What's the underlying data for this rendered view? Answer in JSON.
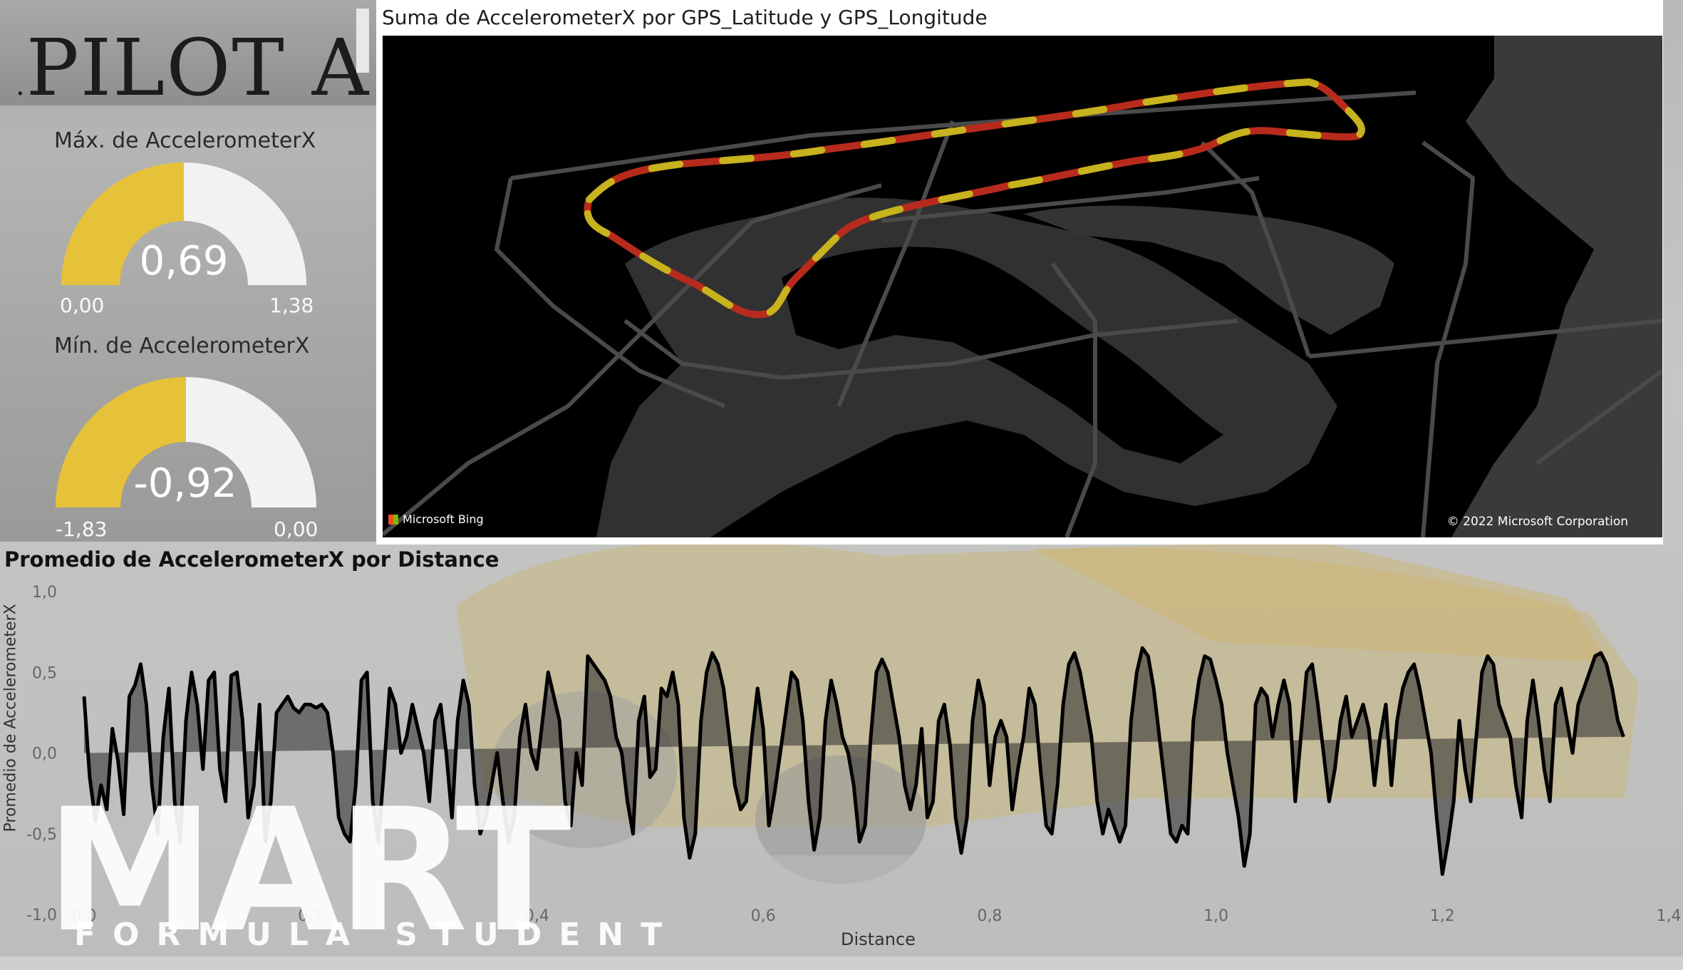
{
  "pilot": {
    "title": "PILOT A",
    "dot": "."
  },
  "gauge_max": {
    "title": "Máx. de AccelerometerX",
    "value": "0,69",
    "min": "0,00",
    "max": "1,38",
    "fill_fraction": 0.5
  },
  "gauge_min": {
    "title": "Mín. de AccelerometerX",
    "value": "-0,92",
    "min": "-1,83",
    "max": "0,00",
    "fill_fraction": 0.5
  },
  "map": {
    "title": "Suma de AccelerometerX por GPS_Latitude y GPS_Longitude",
    "bing": "Microsoft Bing",
    "copyright": "© 2022 Microsoft Corporation"
  },
  "line_chart": {
    "title": "Promedio de AccelerometerX por Distance",
    "xlabel": "Distance",
    "ylabel": "Promedio de AccelerometerX"
  },
  "logo": {
    "main": "MART",
    "sub": "FORMULA STUDENT"
  },
  "colors": {
    "gauge_fill": "#e6c13a",
    "gauge_empty": "#f2f2f2",
    "map_bg": "#000000",
    "line": "#000000"
  },
  "chart_data": {
    "type": "area",
    "title": "Promedio de AccelerometerX por Distance",
    "xlabel": "Distance",
    "ylabel": "Promedio de AccelerometerX",
    "xlim": [
      0,
      1.4
    ],
    "ylim": [
      -1.0,
      1.0
    ],
    "xticks": [
      "0,0",
      "0,2",
      "0,4",
      "0,6",
      "0,8",
      "1,0",
      "1,2",
      "1,4"
    ],
    "yticks": [
      "1,0",
      "0,5",
      "0,0",
      "-0,5",
      "-1,0"
    ],
    "x": [
      0.0,
      0.005,
      0.01,
      0.015,
      0.02,
      0.025,
      0.03,
      0.035,
      0.04,
      0.045,
      0.05,
      0.055,
      0.06,
      0.065,
      0.07,
      0.075,
      0.08,
      0.085,
      0.09,
      0.095,
      0.1,
      0.105,
      0.11,
      0.115,
      0.12,
      0.125,
      0.13,
      0.135,
      0.14,
      0.145,
      0.15,
      0.155,
      0.16,
      0.165,
      0.17,
      0.175,
      0.18,
      0.185,
      0.19,
      0.195,
      0.2,
      0.205,
      0.21,
      0.215,
      0.22,
      0.225,
      0.23,
      0.235,
      0.24,
      0.245,
      0.25,
      0.255,
      0.26,
      0.265,
      0.27,
      0.275,
      0.28,
      0.285,
      0.29,
      0.295,
      0.3,
      0.305,
      0.31,
      0.315,
      0.32,
      0.325,
      0.33,
      0.335,
      0.34,
      0.345,
      0.35,
      0.355,
      0.36,
      0.365,
      0.37,
      0.375,
      0.38,
      0.385,
      0.39,
      0.395,
      0.4,
      0.405,
      0.41,
      0.415,
      0.42,
      0.425,
      0.43,
      0.435,
      0.44,
      0.445,
      0.45,
      0.455,
      0.46,
      0.465,
      0.47,
      0.475,
      0.48,
      0.485,
      0.49,
      0.495,
      0.5,
      0.505,
      0.51,
      0.515,
      0.52,
      0.525,
      0.53,
      0.535,
      0.54,
      0.545,
      0.55,
      0.555,
      0.56,
      0.565,
      0.57,
      0.575,
      0.58,
      0.585,
      0.59,
      0.595,
      0.6,
      0.605,
      0.61,
      0.615,
      0.62,
      0.625,
      0.63,
      0.635,
      0.64,
      0.645,
      0.65,
      0.655,
      0.66,
      0.665,
      0.67,
      0.675,
      0.68,
      0.685,
      0.69,
      0.695,
      0.7,
      0.705,
      0.71,
      0.715,
      0.72,
      0.725,
      0.73,
      0.735,
      0.74,
      0.745,
      0.75,
      0.755,
      0.76,
      0.765,
      0.77,
      0.775,
      0.78,
      0.785,
      0.79,
      0.795,
      0.8,
      0.805,
      0.81,
      0.815,
      0.82,
      0.825,
      0.83,
      0.835,
      0.84,
      0.845,
      0.85,
      0.855,
      0.86,
      0.865,
      0.87,
      0.875,
      0.88,
      0.885,
      0.89,
      0.895,
      0.9,
      0.905,
      0.91,
      0.915,
      0.92,
      0.925,
      0.93,
      0.935,
      0.94,
      0.945,
      0.95,
      0.955,
      0.96,
      0.965,
      0.97,
      0.975,
      0.98,
      0.985,
      0.99,
      0.995,
      1.0,
      1.005,
      1.01,
      1.015,
      1.02,
      1.025,
      1.03,
      1.035,
      1.04,
      1.045,
      1.05,
      1.055,
      1.06,
      1.065,
      1.07,
      1.075,
      1.08,
      1.085,
      1.09,
      1.095,
      1.1,
      1.105,
      1.11,
      1.115,
      1.12,
      1.125,
      1.13,
      1.135,
      1.14,
      1.145,
      1.15,
      1.155,
      1.16,
      1.165,
      1.17,
      1.175,
      1.18,
      1.185,
      1.19,
      1.195,
      1.2,
      1.205,
      1.21,
      1.215,
      1.22,
      1.225,
      1.23,
      1.235,
      1.24,
      1.245,
      1.25,
      1.255,
      1.26,
      1.265,
      1.27,
      1.275,
      1.28,
      1.285,
      1.29,
      1.295,
      1.3,
      1.305,
      1.31,
      1.315,
      1.32,
      1.325,
      1.33,
      1.335,
      1.34,
      1.345,
      1.35,
      1.355,
      1.36,
      1.365,
      1.37,
      1.375,
      1.38
    ],
    "series": [
      {
        "values": [
          0.35,
          -0.15,
          -0.42,
          -0.2,
          -0.35,
          0.15,
          -0.05,
          -0.38,
          0.35,
          0.42,
          0.55,
          0.3,
          -0.2,
          -0.5,
          0.1,
          0.4,
          -0.3,
          -0.55,
          0.2,
          0.5,
          0.3,
          -0.1,
          0.45,
          0.5,
          -0.1,
          -0.3,
          0.48,
          0.5,
          0.2,
          -0.4,
          -0.2,
          0.3,
          -0.55,
          -0.3,
          0.25,
          0.3,
          0.35,
          0.28,
          0.25,
          0.3,
          0.3,
          0.28,
          0.3,
          0.25,
          0.0,
          -0.4,
          -0.5,
          -0.55,
          -0.2,
          0.45,
          0.5,
          -0.3,
          -0.55,
          -0.1,
          0.4,
          0.3,
          0.0,
          0.1,
          0.3,
          0.15,
          0.0,
          -0.3,
          0.2,
          0.3,
          0.0,
          -0.4,
          0.2,
          0.45,
          0.3,
          -0.2,
          -0.5,
          -0.4,
          -0.2,
          0.0,
          -0.3,
          -0.55,
          -0.4,
          0.1,
          0.3,
          0.0,
          -0.1,
          0.2,
          0.5,
          0.35,
          0.2,
          -0.3,
          -0.45,
          0.0,
          -0.2,
          0.6,
          0.55,
          0.5,
          0.45,
          0.35,
          0.1,
          0.0,
          -0.3,
          -0.5,
          0.2,
          0.35,
          -0.15,
          -0.1,
          0.4,
          0.35,
          0.5,
          0.3,
          -0.4,
          -0.65,
          -0.5,
          0.2,
          0.5,
          0.62,
          0.55,
          0.4,
          0.1,
          -0.2,
          -0.35,
          -0.3,
          0.1,
          0.4,
          0.15,
          -0.45,
          -0.25,
          0.0,
          0.25,
          0.5,
          0.45,
          0.2,
          -0.3,
          -0.6,
          -0.4,
          0.2,
          0.45,
          0.3,
          0.1,
          0.0,
          -0.2,
          -0.55,
          -0.45,
          0.1,
          0.5,
          0.58,
          0.5,
          0.3,
          0.1,
          -0.2,
          -0.35,
          -0.2,
          0.15,
          -0.4,
          -0.3,
          0.2,
          0.3,
          0.05,
          -0.4,
          -0.62,
          -0.4,
          0.2,
          0.45,
          0.3,
          -0.2,
          0.1,
          0.2,
          0.1,
          -0.35,
          -0.1,
          0.1,
          0.4,
          0.3,
          -0.1,
          -0.45,
          -0.5,
          -0.2,
          0.3,
          0.55,
          0.62,
          0.5,
          0.3,
          0.1,
          -0.3,
          -0.5,
          -0.35,
          -0.45,
          -0.55,
          -0.45,
          0.2,
          0.5,
          0.65,
          0.6,
          0.4,
          0.1,
          -0.2,
          -0.5,
          -0.55,
          -0.45,
          -0.5,
          0.2,
          0.45,
          0.6,
          0.58,
          0.45,
          0.3,
          0.0,
          -0.2,
          -0.4,
          -0.7,
          -0.5,
          0.3,
          0.4,
          0.35,
          0.1,
          0.3,
          0.45,
          0.3,
          -0.3,
          0.1,
          0.5,
          0.55,
          0.3,
          0.0,
          -0.3,
          -0.1,
          0.2,
          0.35,
          0.1,
          0.2,
          0.3,
          0.15,
          -0.2,
          0.1,
          0.3,
          -0.2,
          0.2,
          0.4,
          0.5,
          0.55,
          0.4,
          0.2,
          0.0,
          -0.4,
          -0.75,
          -0.55,
          -0.3,
          0.2,
          -0.1,
          -0.3,
          0.1,
          0.5,
          0.6,
          0.55,
          0.3,
          0.2,
          0.1,
          -0.2,
          -0.4,
          0.2,
          0.45,
          0.2,
          -0.1,
          -0.3,
          0.3,
          0.4,
          0.2,
          0.0,
          0.3,
          0.4,
          0.5,
          0.6,
          0.62,
          0.55,
          0.4,
          0.2,
          0.1
        ]
      }
    ]
  }
}
